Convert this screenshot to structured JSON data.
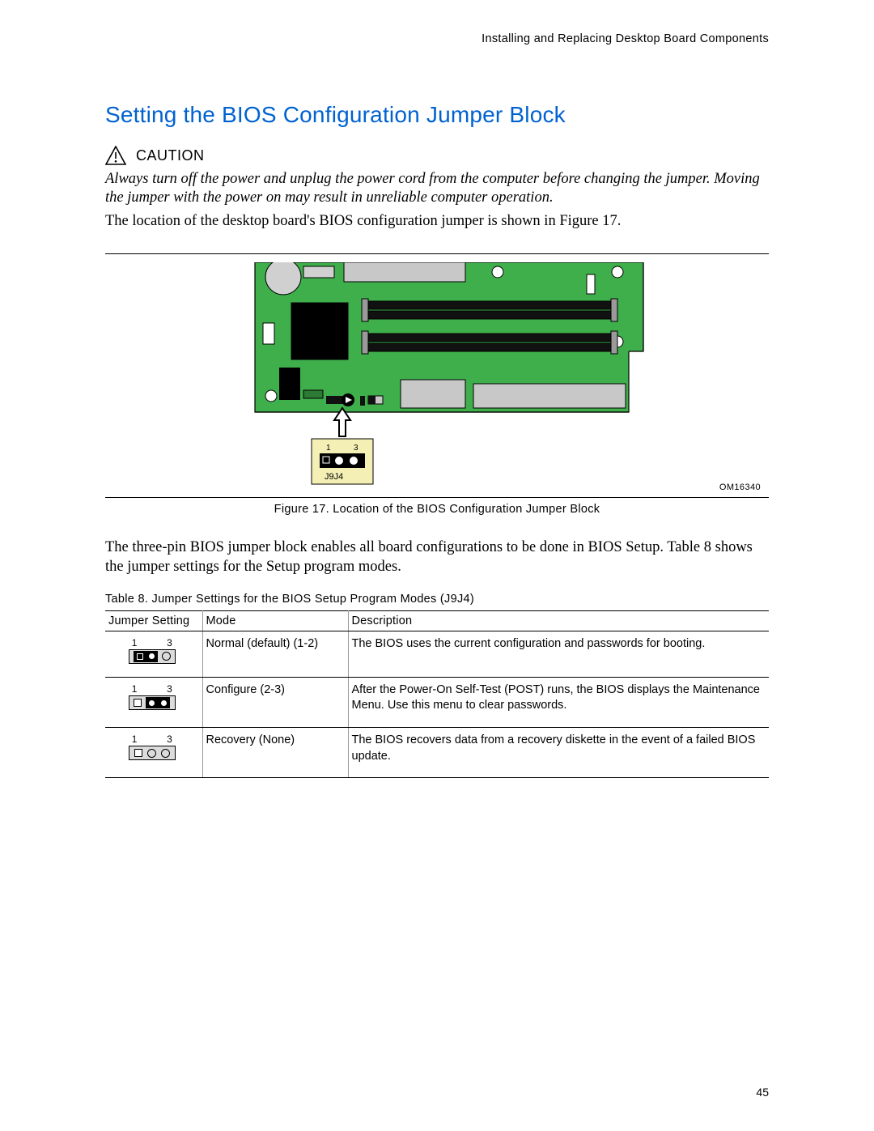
{
  "header": "Installing and Replacing Desktop Board Components",
  "main_heading": "Setting the BIOS Configuration Jumper Block",
  "caution_label": "CAUTION",
  "caution_italic": "Always turn off the power and unplug the power cord from the computer before changing the jumper.  Moving the jumper with the power on may result in unreliable computer operation.",
  "paragraph_1": "The location of the desktop board's BIOS configuration jumper is shown in Figure 17.",
  "figure_id": "OM16340",
  "figure_caption": "Figure 17.  Location of the BIOS Configuration Jumper Block",
  "jumper_callout_label": "J9J4",
  "paragraph_2": "The three-pin BIOS jumper block enables all board configurations to be done in BIOS Setup.  Table 8 shows the jumper settings for the Setup program modes.",
  "table_title": "Table 8.      Jumper Settings for the BIOS Setup Program Modes (J9J4)",
  "table": {
    "headers": [
      "Jumper Setting",
      "Mode",
      "Description"
    ],
    "rows": [
      {
        "pins": {
          "one": "1",
          "three": "3"
        },
        "mode": "Normal (default) (1-2)",
        "description": "The BIOS uses the current configuration and passwords for booting."
      },
      {
        "pins": {
          "one": "1",
          "three": "3"
        },
        "mode": "Configure (2-3)",
        "description": "After the Power-On Self-Test (POST) runs, the BIOS displays the Maintenance Menu.  Use this menu to clear passwords."
      },
      {
        "pins": {
          "one": "1",
          "three": "3"
        },
        "mode": "Recovery (None)",
        "description": "The BIOS recovers data from a recovery diskette in the event of a failed BIOS update."
      }
    ]
  },
  "page_number": "45"
}
